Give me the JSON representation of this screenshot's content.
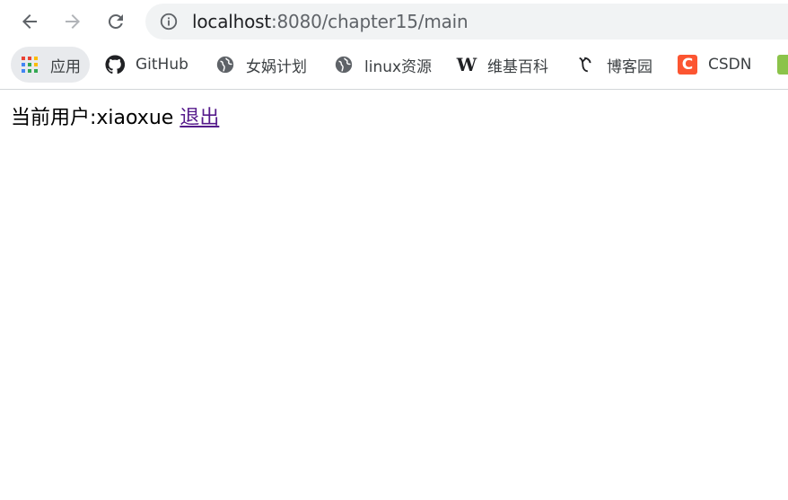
{
  "browser": {
    "url_host": "localhost",
    "url_rest": ":8080/chapter15/main"
  },
  "bookmarks": [
    {
      "label": "应用",
      "icon": "apps-grid-icon"
    },
    {
      "label": "GitHub",
      "icon": "github-icon"
    },
    {
      "label": "女娲计划",
      "icon": "globe-icon"
    },
    {
      "label": "linux资源",
      "icon": "globe-icon"
    },
    {
      "label": "维基百科",
      "icon": "wikipedia-icon"
    },
    {
      "label": "博客园",
      "icon": "cnblogs-icon"
    },
    {
      "label": "CSDN",
      "icon": "csdn-icon"
    }
  ],
  "page": {
    "user_prefix": "当前用户:xiaoxue",
    "logout_link": "退出"
  },
  "colors": {
    "link_visited": "#551a8b",
    "omnibox_bg": "#f1f3f4",
    "csdn_brand": "#fc5531"
  }
}
